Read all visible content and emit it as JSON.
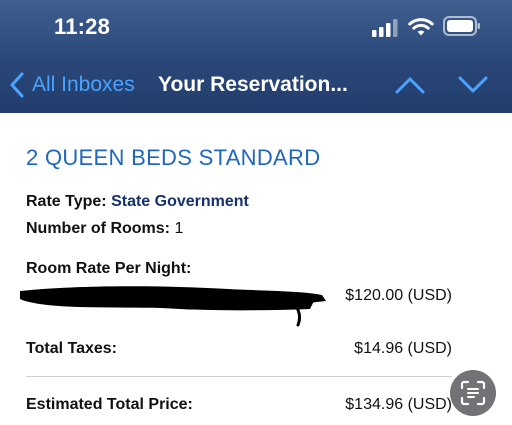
{
  "status_bar": {
    "time": "11:28"
  },
  "nav": {
    "back_label": "All Inboxes",
    "title": "Your Reservation..."
  },
  "reservation": {
    "room_type": "2 QUEEN BEDS STANDARD",
    "rate_type_label": "Rate Type:",
    "rate_type_value": "State Government",
    "rooms_label": "Number of Rooms:",
    "rooms_value": "1",
    "rate_per_night_label": "Room Rate Per Night:",
    "rate_per_night_value": "$120.00 (USD)",
    "taxes_label": "Total Taxes:",
    "taxes_value": "$14.96 (USD)",
    "total_label": "Estimated Total Price:",
    "total_value": "$134.96 (USD)"
  },
  "colors": {
    "nav_background": "#2a4778",
    "link_blue": "#4aa3ff",
    "heading_blue": "#1f66c1",
    "rate_value": "#16306e"
  },
  "icons": {
    "signal": "cellular-signal-icon",
    "wifi": "wifi-icon",
    "battery": "battery-icon",
    "back": "chevron-left-icon",
    "up": "chevron-up-icon",
    "down": "chevron-down-icon",
    "live_text": "live-text-scan-icon"
  }
}
